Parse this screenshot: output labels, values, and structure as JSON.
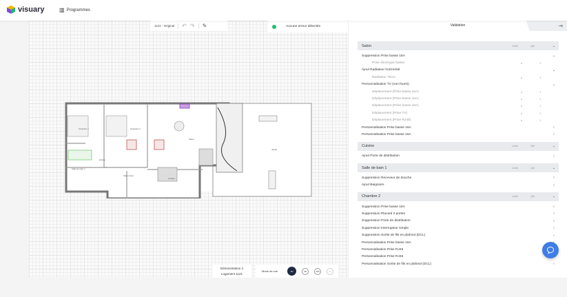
{
  "header": {
    "brand": "visuary",
    "nav_programmes": "Programmes"
  },
  "toolbar": {
    "version": "1121 - Original"
  },
  "status": {
    "message": "Aucune erreur détectée",
    "color": "#1dbf73"
  },
  "panel": {
    "tab": "Validation",
    "col_unit": "Unité",
    "col_qty": "Qté",
    "sections": [
      {
        "title": "Salon",
        "rows": [
          {
            "label": "Suppression Prise basse 16A",
            "expanded": true,
            "items": [
              {
                "label": "Prise électrique basse",
                "unit": "u",
                "qty": "1"
              }
            ]
          },
          {
            "label": "Ajout Radiateur horizontal",
            "expanded": true,
            "items": [
              {
                "label": "Radiateur 75cm",
                "unit": "u",
                "qty": "1"
              }
            ]
          },
          {
            "label": "Personnalisation TV (non fourni)",
            "expanded": true,
            "items": [
              {
                "label": "Déplacement (Prise basse 16A)",
                "unit": "u",
                "qty": "1"
              },
              {
                "label": "Déplacement (Prise basse 16A)",
                "unit": "u",
                "qty": "1"
              },
              {
                "label": "Déplacement (Prise basse 16A)",
                "unit": "u",
                "qty": "1"
              },
              {
                "label": "Déplacement (Prise TV)",
                "unit": "u",
                "qty": "1"
              },
              {
                "label": "Déplacement (Prise RJ45)",
                "unit": "u",
                "qty": "1"
              }
            ]
          },
          {
            "label": "Personnalisation Prise basse 16A",
            "expanded": false,
            "items": []
          },
          {
            "label": "Personnalisation Prise basse 16A",
            "expanded": false,
            "items": []
          }
        ]
      },
      {
        "title": "Cuisine",
        "rows": [
          {
            "label": "Ajout Porte de distribution",
            "expanded": false,
            "items": []
          }
        ]
      },
      {
        "title": "Salle de bain 1",
        "rows": [
          {
            "label": "Suppression Receveur de douche",
            "expanded": false,
            "items": []
          },
          {
            "label": "Ajout Baignoire",
            "expanded": false,
            "items": []
          }
        ]
      },
      {
        "title": "Chambre 2",
        "rows": [
          {
            "label": "Suppression Prise basse 16A",
            "expanded": false,
            "items": []
          },
          {
            "label": "Suppression Placard 2 portes",
            "expanded": false,
            "items": []
          },
          {
            "label": "Suppression Porte de distribution",
            "expanded": false,
            "items": []
          },
          {
            "label": "Suppression Interrupteur simple",
            "expanded": false,
            "items": []
          },
          {
            "label": "Suppression Sortie de fils en plafond (DCL)",
            "expanded": false,
            "items": []
          },
          {
            "label": "Personnalisation Prise basse 16A",
            "expanded": false,
            "items": []
          },
          {
            "label": "Personnalisation Prise RJ45",
            "expanded": false,
            "items": []
          },
          {
            "label": "Personnalisation Prise RJ45",
            "expanded": false,
            "items": []
          },
          {
            "label": "Personnalisation Sortie de fils en plafond (DCL)",
            "expanded": false,
            "items": []
          }
        ]
      }
    ]
  },
  "demo": {
    "line1": "Démonstration 4",
    "line2": "Logement 1121"
  },
  "view": {
    "label": "Mode de vue",
    "buttons": [
      "2D",
      "3D",
      "360",
      "iso"
    ],
    "active": "2D"
  },
  "plan": {
    "rooms": [
      "Chambre 1",
      "Chambre 2",
      "Salon",
      "Jardin",
      "Entrée",
      "Salle de bain 1",
      "Salle d'eau",
      "Cuisine"
    ]
  }
}
